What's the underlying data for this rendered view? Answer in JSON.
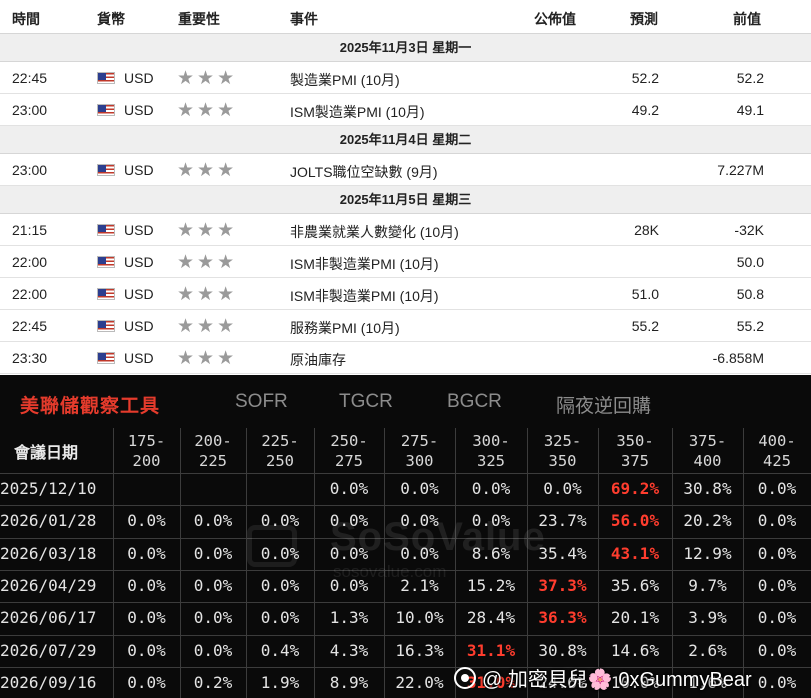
{
  "calendar": {
    "headers": {
      "time": "時間",
      "currency": "貨幣",
      "importance": "重要性",
      "event": "事件",
      "actual": "公佈值",
      "forecast": "預測",
      "previous": "前值"
    },
    "star_glyphs": "★★★",
    "rows": [
      {
        "type": "day",
        "label": "2025年11月3日  星期一"
      },
      {
        "type": "event",
        "time": "22:45",
        "currency": "USD",
        "event": "製造業PMI (10月)",
        "forecast": "52.2",
        "previous": "52.2"
      },
      {
        "type": "event",
        "time": "23:00",
        "currency": "USD",
        "event": "ISM製造業PMI (10月)",
        "forecast": "49.2",
        "previous": "49.1"
      },
      {
        "type": "day",
        "label": "2025年11月4日  星期二"
      },
      {
        "type": "event",
        "time": "23:00",
        "currency": "USD",
        "event": "JOLTS職位空缺數 (9月)",
        "forecast": "",
        "previous": "7.227M"
      },
      {
        "type": "day",
        "label": "2025年11月5日  星期三"
      },
      {
        "type": "event",
        "time": "21:15",
        "currency": "USD",
        "event": "非農業就業人數變化 (10月)",
        "forecast": "28K",
        "previous": "-32K"
      },
      {
        "type": "event",
        "time": "22:00",
        "currency": "USD",
        "event": "ISM非製造業PMI (10月)",
        "forecast": "",
        "previous": "50.0"
      },
      {
        "type": "event",
        "time": "22:00",
        "currency": "USD",
        "event": "ISM非製造業PMI (10月)",
        "forecast": "51.0",
        "previous": "50.8"
      },
      {
        "type": "event",
        "time": "22:45",
        "currency": "USD",
        "event": "服務業PMI (10月)",
        "forecast": "55.2",
        "previous": "55.2"
      },
      {
        "type": "event",
        "time": "23:30",
        "currency": "USD",
        "event": "原油庫存",
        "forecast": "",
        "previous": "-6.858M"
      }
    ]
  },
  "fed_tool": {
    "tabs": [
      "美聯儲觀察工具",
      "SOFR",
      "TGCR",
      "BGCR",
      "隔夜逆回購"
    ],
    "active_tab": 0,
    "date_header": "會議日期",
    "ranges": [
      [
        "175-",
        "200"
      ],
      [
        "200-",
        "225"
      ],
      [
        "225-",
        "250"
      ],
      [
        "250-",
        "275"
      ],
      [
        "275-",
        "300"
      ],
      [
        "300-",
        "325"
      ],
      [
        "325-",
        "350"
      ],
      [
        "350-",
        "375"
      ],
      [
        "375-",
        "400"
      ],
      [
        "400-",
        "425"
      ]
    ],
    "highlight_color": "#ff3d2e",
    "rows": [
      {
        "date": "2025/12/10",
        "values": [
          "",
          "",
          "",
          "0.0%",
          "0.0%",
          "0.0%",
          "0.0%",
          "69.2%",
          "30.8%",
          "0.0%"
        ],
        "highlight": 7
      },
      {
        "date": "2026/01/28",
        "values": [
          "0.0%",
          "0.0%",
          "0.0%",
          "0.0%",
          "0.0%",
          "0.0%",
          "23.7%",
          "56.0%",
          "20.2%",
          "0.0%"
        ],
        "highlight": 7
      },
      {
        "date": "2026/03/18",
        "values": [
          "0.0%",
          "0.0%",
          "0.0%",
          "0.0%",
          "0.0%",
          "8.6%",
          "35.4%",
          "43.1%",
          "12.9%",
          "0.0%"
        ],
        "highlight": 7
      },
      {
        "date": "2026/04/29",
        "values": [
          "0.0%",
          "0.0%",
          "0.0%",
          "0.0%",
          "2.1%",
          "15.2%",
          "37.3%",
          "35.6%",
          "9.7%",
          "0.0%"
        ],
        "highlight": 6
      },
      {
        "date": "2026/06/17",
        "values": [
          "0.0%",
          "0.0%",
          "0.0%",
          "1.3%",
          "10.0%",
          "28.4%",
          "36.3%",
          "20.1%",
          "3.9%",
          "0.0%"
        ],
        "highlight": 6
      },
      {
        "date": "2026/07/29",
        "values": [
          "0.0%",
          "0.0%",
          "0.4%",
          "4.3%",
          "16.3%",
          "31.1%",
          "30.8%",
          "14.6%",
          "2.6%",
          "0.0%"
        ],
        "highlight": 5
      },
      {
        "date": "2026/09/16",
        "values": [
          "0.0%",
          "0.2%",
          "1.9%",
          "8.9%",
          "22.0%",
          "31.0%",
          "24.6%",
          "10.0%",
          "1.6%",
          "0.0%"
        ],
        "highlight": 5
      }
    ],
    "watermark": {
      "brand": "SoSoValue",
      "site": "sosovalue.com"
    },
    "credit": "@ 加密貝兒🌸 0xGummyBear"
  }
}
